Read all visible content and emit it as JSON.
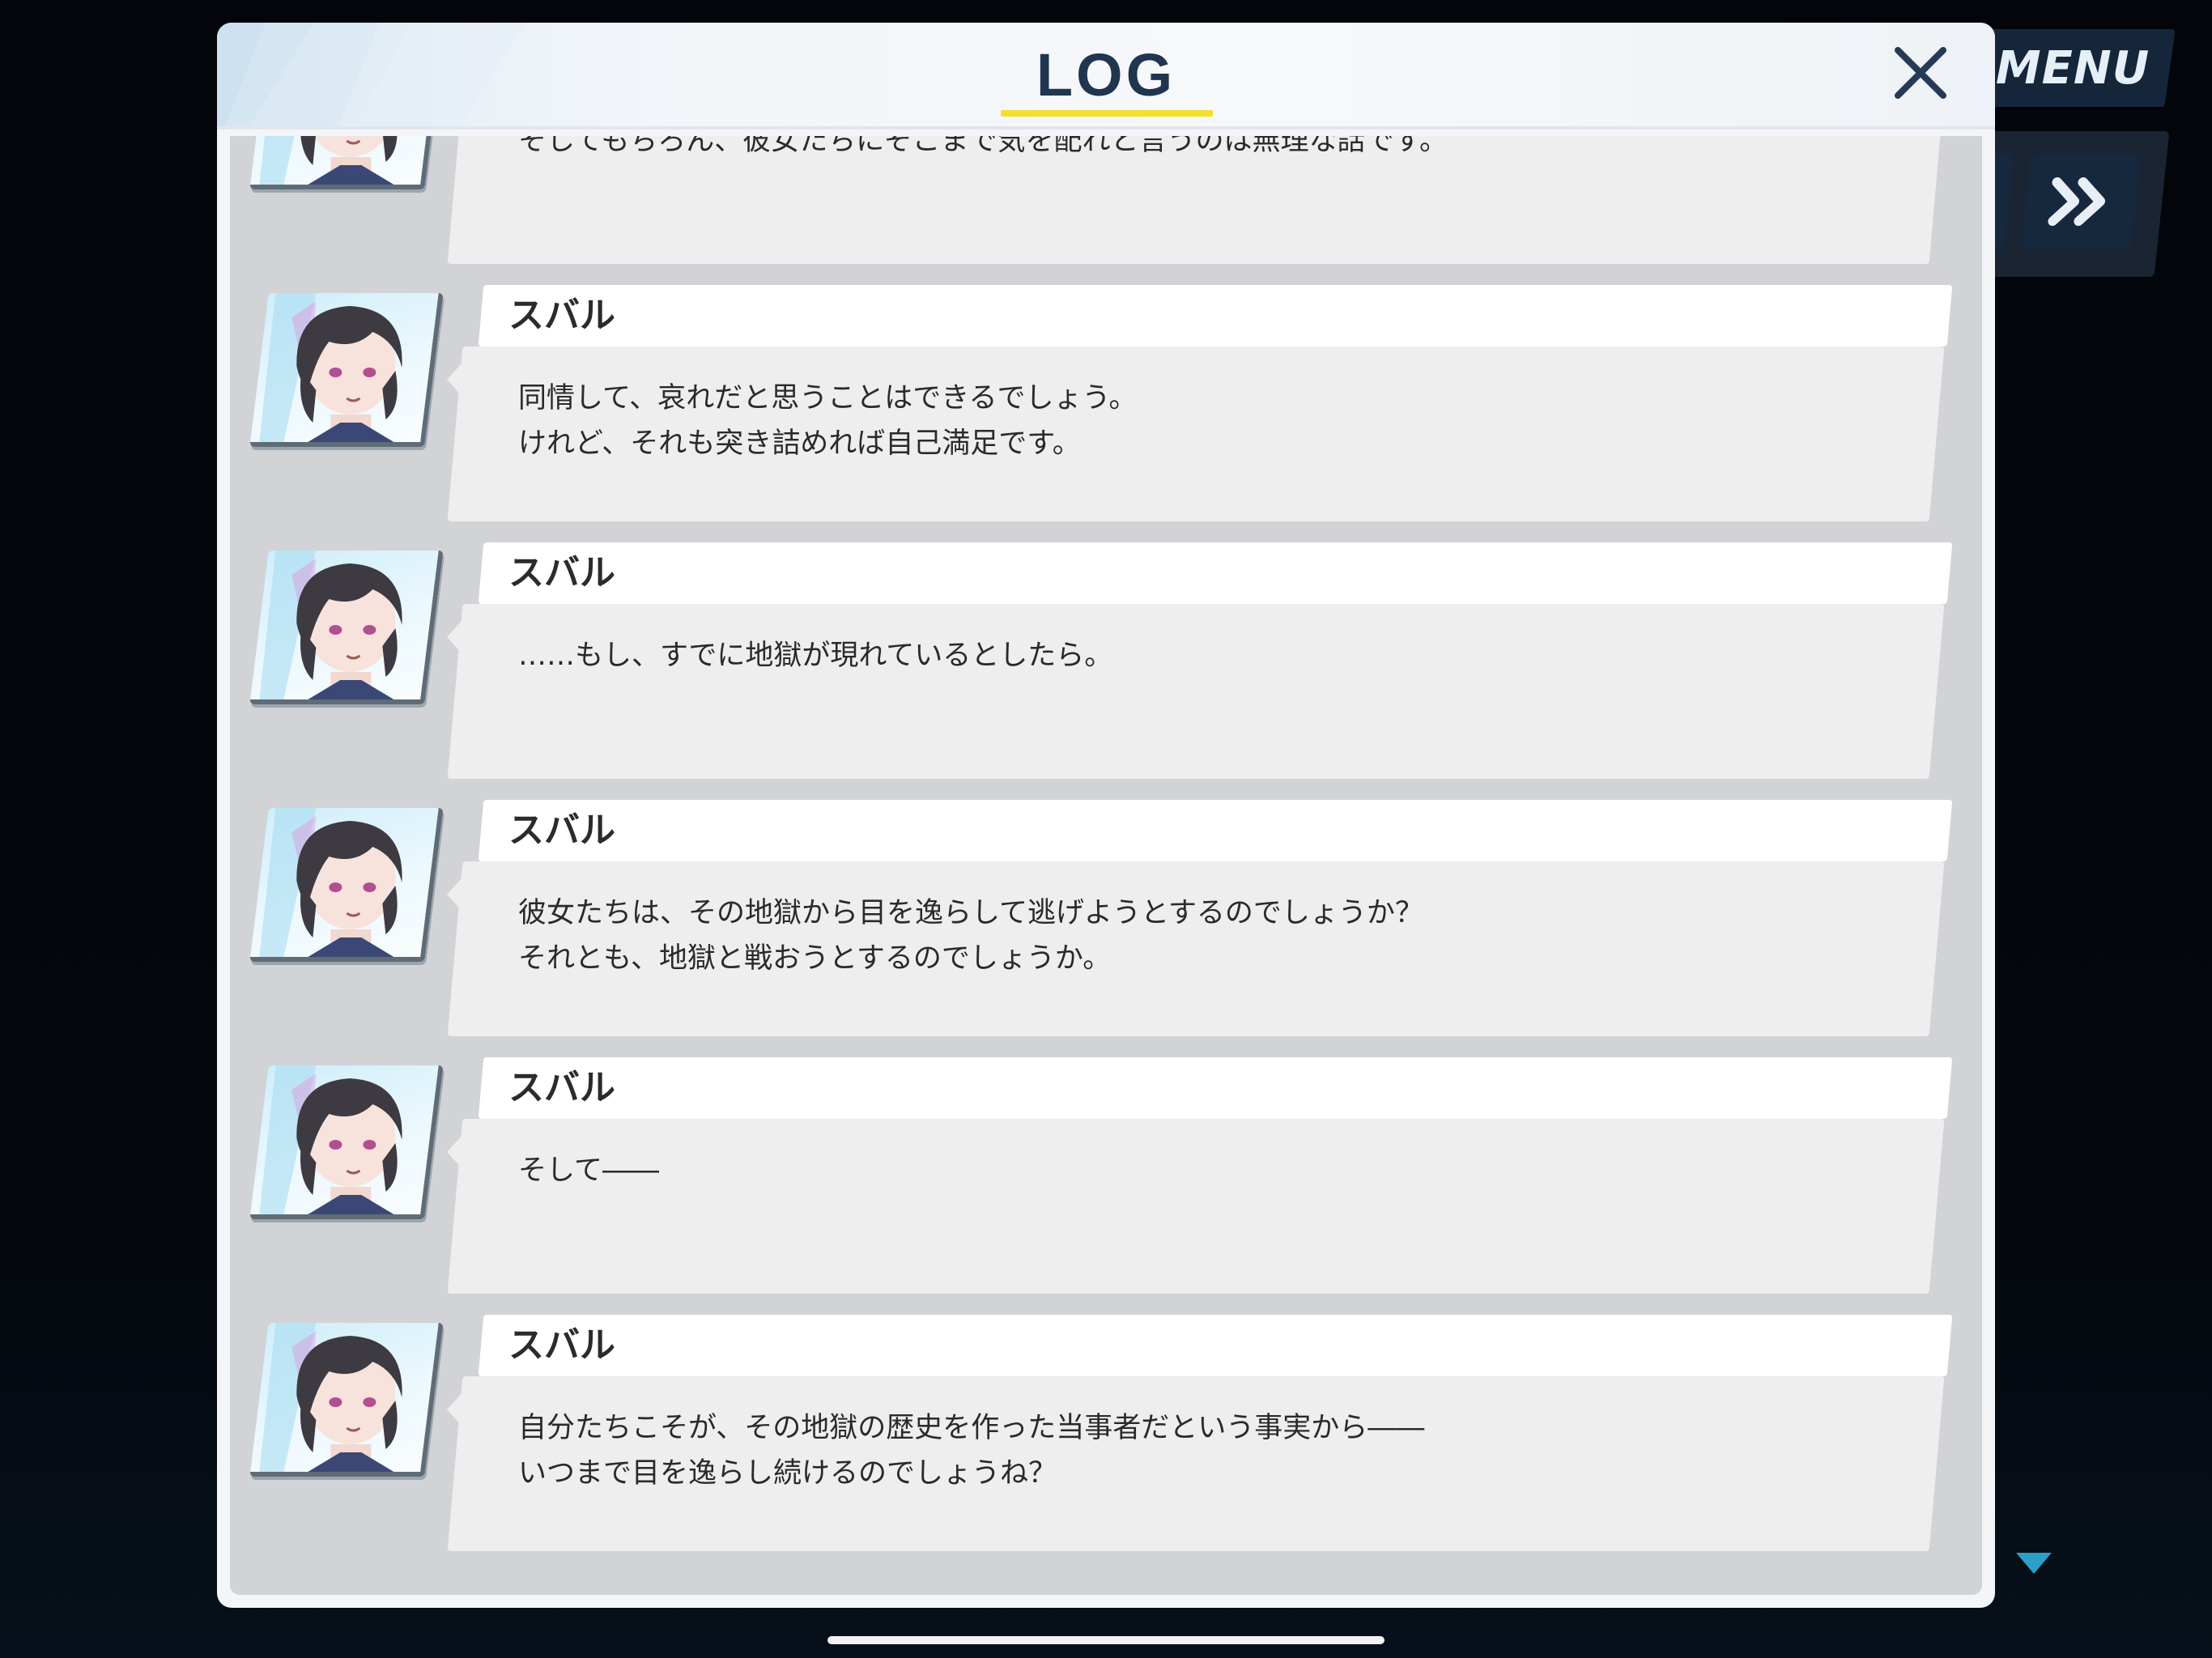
{
  "hud": {
    "menu_label": "MENU",
    "skip_icon": "double-chevron-right-icon",
    "scroll_indicator_icon": "triangle-down-icon"
  },
  "log": {
    "title": "LOG",
    "close_icon": "close-icon",
    "colors": {
      "title": "#1f3550",
      "underline": "#f2e02a",
      "panel": "#f3f5f8",
      "list_background": "#d1d3d6",
      "name_bar": "#ffffff",
      "text_box": "#eeeeee"
    },
    "entries": [
      {
        "speaker": "",
        "lines": [
          "そしてもちろん、彼女たちにそこまで気を配れと言うのは無理な話です。"
        ]
      },
      {
        "speaker": "スバル",
        "lines": [
          "同情して、哀れだと思うことはできるでしょう。",
          "けれど、それも突き詰めれば自己満足です。"
        ]
      },
      {
        "speaker": "スバル",
        "lines": [
          "……もし、すでに地獄が現れているとしたら。"
        ]
      },
      {
        "speaker": "スバル",
        "lines": [
          "彼女たちは、その地獄から目を逸らして逃げようとするのでしょうか？",
          "それとも、地獄と戦おうとするのでしょうか。"
        ]
      },
      {
        "speaker": "スバル",
        "lines": [
          "そして――"
        ]
      },
      {
        "speaker": "スバル",
        "lines": [
          "自分たちこそが、その地獄の歴史を作った当事者だという事実から――",
          "いつまで目を逸らし続けるのでしょうね？"
        ]
      }
    ]
  }
}
